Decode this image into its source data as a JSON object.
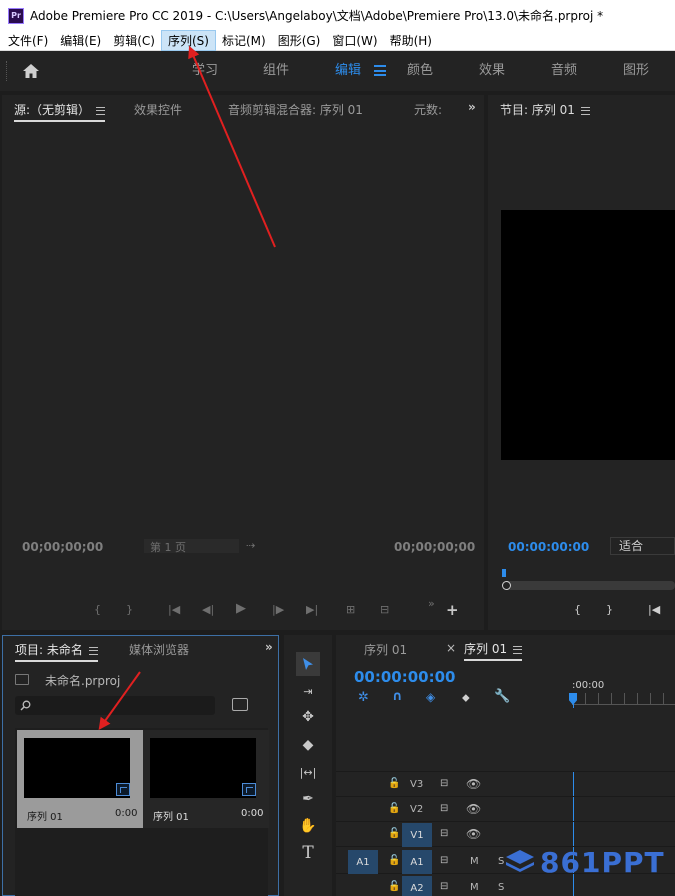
{
  "window": {
    "app_icon_text": "Pr",
    "title": "Adobe Premiere Pro CC 2019 - C:\\Users\\Angelaboy\\文档\\Adobe\\Premiere Pro\\13.0\\未命名.prproj *"
  },
  "menu": {
    "items": [
      {
        "label": "文件(F)"
      },
      {
        "label": "编辑(E)"
      },
      {
        "label": "剪辑(C)"
      },
      {
        "label": "序列(S)"
      },
      {
        "label": "标记(M)"
      },
      {
        "label": "图形(G)"
      },
      {
        "label": "窗口(W)"
      },
      {
        "label": "帮助(H)"
      }
    ],
    "active_index": 3
  },
  "workspace": {
    "tabs": [
      "学习",
      "组件",
      "编辑",
      "颜色",
      "效果",
      "音频",
      "图形"
    ],
    "active": "编辑"
  },
  "source_panel": {
    "tabs": [
      "源:（无剪辑）",
      "效果控件",
      "音频剪辑混合器: 序列 01",
      "元数:"
    ],
    "timecode_left": "00;00;00;00",
    "timecode_right": "00;00;00;00",
    "page_label": "第 1 页"
  },
  "program_panel": {
    "tab": "节目: 序列 01",
    "timecode": "00:00:00:00",
    "fit_label": "适合"
  },
  "project_panel": {
    "tabs": [
      "项目: 未命名",
      "媒体浏览器"
    ],
    "file_name": "未命名.prproj",
    "search_placeholder": "",
    "items": [
      {
        "name": "序列 01",
        "duration": "0:00"
      },
      {
        "name": "序列 01",
        "duration": "0:00"
      }
    ]
  },
  "timeline_panel": {
    "tabs": [
      "序列 01",
      "序列 01"
    ],
    "timecode": "00:00:00:00",
    "ruler_label": ":00:00",
    "tracks": [
      {
        "name": "V3"
      },
      {
        "name": "V2"
      },
      {
        "name": "V1"
      },
      {
        "name": "A1",
        "source": "A1",
        "m": "M",
        "s": "S"
      },
      {
        "name": "A2",
        "m": "M",
        "s": "S"
      }
    ]
  },
  "watermark": {
    "text": "861PPT"
  },
  "colors": {
    "accent": "#2d8ceb",
    "panel_bg": "#232323",
    "gutter": "#1a1a1a",
    "annotation_arrow": "#e02020"
  }
}
